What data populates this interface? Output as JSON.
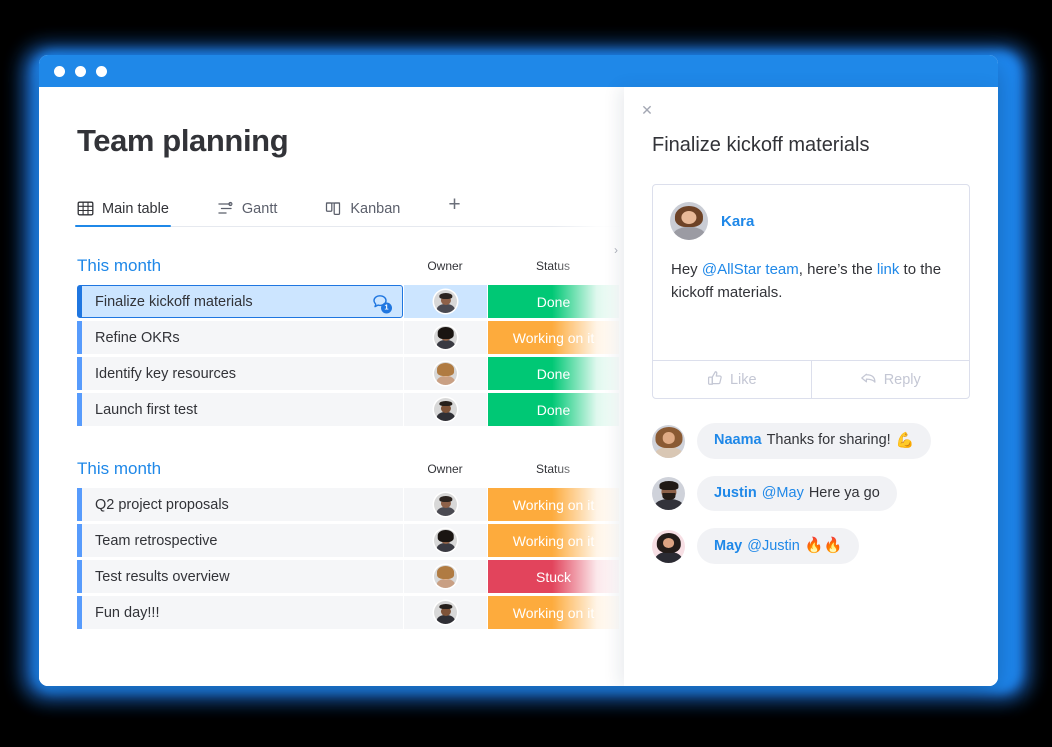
{
  "window": {
    "traffic_lights": [
      "close",
      "minimize",
      "maximize"
    ]
  },
  "board": {
    "title": "Team planning",
    "tabs": [
      {
        "label": "Main table",
        "icon": "table-icon",
        "active": true
      },
      {
        "label": "Gantt",
        "icon": "gantt-icon",
        "active": false
      },
      {
        "label": "Kanban",
        "icon": "kanban-icon",
        "active": false
      }
    ],
    "add_tab_label": "+",
    "scroll_chevron": "›",
    "columns": {
      "name": "",
      "owner": "Owner",
      "status": "Status"
    },
    "groups": [
      {
        "title": "This month",
        "rows": [
          {
            "name": "Finalize kickoff materials",
            "owner": "avatar-man-dark-1",
            "status": "Done",
            "status_color": "#00c875",
            "selected": true,
            "badge": "1",
            "badge_icon": "comment-bubble-icon"
          },
          {
            "name": "Refine OKRs",
            "owner": "avatar-woman-dark-1",
            "status": "Working on it",
            "status_color": "#fdab3d",
            "selected": false
          },
          {
            "name": "Identify key resources",
            "owner": "avatar-woman-blonde",
            "status": "Done",
            "status_color": "#00c875",
            "selected": false
          },
          {
            "name": "Launch first test",
            "owner": "avatar-man-beard",
            "status": "Done",
            "status_color": "#00c875",
            "selected": false
          }
        ]
      },
      {
        "title": "This month",
        "rows": [
          {
            "name": "Q2 project proposals",
            "owner": "avatar-man-dark-1",
            "status": "Working on it",
            "status_color": "#fdab3d",
            "selected": false
          },
          {
            "name": "Team retrospective",
            "owner": "avatar-woman-dark-1",
            "status": "Working on it",
            "status_color": "#fdab3d",
            "selected": false
          },
          {
            "name": "Test results overview",
            "owner": "avatar-woman-blonde",
            "status": "Stuck",
            "status_color": "#e2445c",
            "selected": false
          },
          {
            "name": "Fun day!!!",
            "owner": "avatar-man-beard",
            "status": "Working on it",
            "status_color": "#fdab3d",
            "selected": false
          }
        ]
      }
    ]
  },
  "panel": {
    "close_label": "✕",
    "title": "Finalize kickoff materials",
    "update": {
      "author": "Kara",
      "avatar": "avatar-kara",
      "text_parts": [
        {
          "type": "text",
          "value": "Hey "
        },
        {
          "type": "mention",
          "value": "@AllStar team"
        },
        {
          "type": "text",
          "value": ", here’s the "
        },
        {
          "type": "link",
          "value": "link"
        },
        {
          "type": "text",
          "value": " to the kickoff materials."
        }
      ],
      "like_label": "Like",
      "reply_label": "Reply"
    },
    "comments": [
      {
        "author": "Naama",
        "avatar": "avatar-naama",
        "text": "Thanks for sharing!",
        "mention": "",
        "emoji": "💪"
      },
      {
        "author": "Justin",
        "avatar": "avatar-justin",
        "mention": "@May",
        "text": "Here ya go",
        "emoji": ""
      },
      {
        "author": "May",
        "avatar": "avatar-may",
        "mention": "@Justin",
        "text": "",
        "emoji": "🔥🔥"
      }
    ]
  },
  "colors": {
    "brand_blue": "#1f88e8",
    "done_green": "#00c875",
    "working_orange": "#fdab3d",
    "stuck_red": "#e2445c",
    "row_accent": "#579bfc",
    "page_bg": "#000000"
  }
}
